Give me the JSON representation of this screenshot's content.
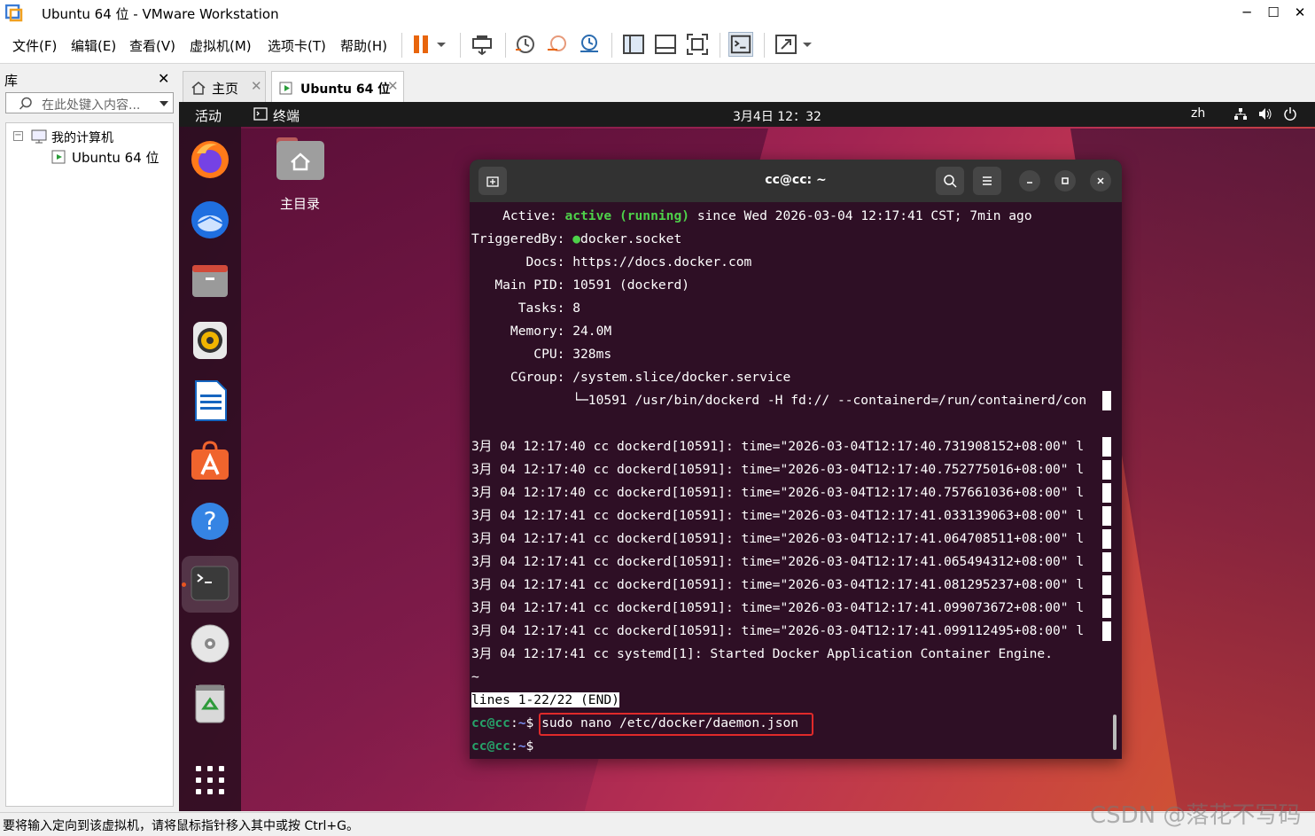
{
  "window": {
    "title": "Ubuntu 64 位 - VMware Workstation",
    "minimize": "─",
    "maximize": "☐",
    "close": "✕"
  },
  "menu": [
    "文件(F)",
    "编辑(E)",
    "查看(V)",
    "虚拟机(M)",
    "选项卡(T)",
    "帮助(H)"
  ],
  "library": {
    "title": "库",
    "close": "✕",
    "search_placeholder": "在此处键入内容...",
    "tree": {
      "root": "我的计算机",
      "child": "Ubuntu 64 位"
    }
  },
  "tabs": [
    {
      "label": "主页"
    },
    {
      "label": "Ubuntu 64 位"
    }
  ],
  "ubuntu": {
    "activities": "活动",
    "app_name": "终端",
    "clock": "3月4日  12：32",
    "lang": "zh",
    "desktop_icon_label": "主目录"
  },
  "terminal": {
    "title": "cc@cc: ~",
    "lines": [
      {
        "pre": "    Active: ",
        "green": "active (running)",
        "post": " since Wed 2026-03-04 12:17:41 CST; 7min ago"
      },
      {
        "pre": "TriggeredBy: ",
        "dot": "●",
        "post": "docker.socket"
      },
      {
        "pre": "       Docs: https://docs.docker.com"
      },
      {
        "pre": "   Main PID: 10591 (dockerd)"
      },
      {
        "pre": "      Tasks: 8"
      },
      {
        "pre": "     Memory: 24.0M"
      },
      {
        "pre": "        CPU: 328ms"
      },
      {
        "pre": "     CGroup: /system.slice/docker.service"
      },
      {
        "pre": "             └─10591 /usr/bin/dockerd -H fd:// --containerd=/run/containerd/con"
      },
      {
        "pre": ""
      },
      {
        "pre": "3月 04 12:17:40 cc dockerd[10591]: time=\"2026-03-04T12:17:40.731908152+08:00\" l"
      },
      {
        "pre": "3月 04 12:17:40 cc dockerd[10591]: time=\"2026-03-04T12:17:40.752775016+08:00\" l"
      },
      {
        "pre": "3月 04 12:17:40 cc dockerd[10591]: time=\"2026-03-04T12:17:40.757661036+08:00\" l"
      },
      {
        "pre": "3月 04 12:17:41 cc dockerd[10591]: time=\"2026-03-04T12:17:41.033139063+08:00\" l"
      },
      {
        "pre": "3月 04 12:17:41 cc dockerd[10591]: time=\"2026-03-04T12:17:41.064708511+08:00\" l"
      },
      {
        "pre": "3月 04 12:17:41 cc dockerd[10591]: time=\"2026-03-04T12:17:41.065494312+08:00\" l"
      },
      {
        "pre": "3月 04 12:17:41 cc dockerd[10591]: time=\"2026-03-04T12:17:41.081295237+08:00\" l"
      },
      {
        "pre": "3月 04 12:17:41 cc dockerd[10591]: time=\"2026-03-04T12:17:41.099073672+08:00\" l"
      },
      {
        "pre": "3月 04 12:17:41 cc dockerd[10591]: time=\"2026-03-04T12:17:41.099112495+08:00\" l"
      },
      {
        "pre": "3月 04 12:17:41 cc systemd[1]: Started Docker Application Container Engine."
      },
      {
        "pre": "~"
      }
    ],
    "pager_status": "lines 1-22/22 (END)",
    "prompt_user": "cc@cc",
    "prompt_sep": ":",
    "prompt_path": "~",
    "prompt_dollar": "$ ",
    "command": "sudo nano /etc/docker/daemon.json"
  },
  "statusbar": {
    "hint": "要将输入定向到该虚拟机，请将鼠标指针移入其中或按 Ctrl+G。",
    "watermark": "CSDN @落花不写码"
  },
  "colors": {
    "accent_red": "#e02a2a",
    "term_bg": "#2e0f25",
    "prompt_green": "#26a269",
    "prompt_blue": "#7a8ff2"
  }
}
